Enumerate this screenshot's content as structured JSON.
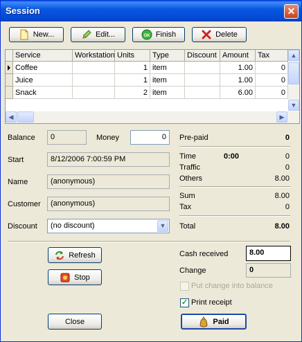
{
  "window": {
    "title": "Session"
  },
  "toolbar": {
    "new_label": "New...",
    "edit_label": "Edit...",
    "finish_label": "Finish",
    "delete_label": "Delete"
  },
  "grid": {
    "columns": [
      "Service",
      "Workstation",
      "Units",
      "Type",
      "Discount",
      "Amount",
      "Tax"
    ],
    "rows": [
      {
        "service": "Coffee",
        "workstation": "",
        "units": "1",
        "type": "item",
        "discount": "",
        "amount": "1.00",
        "tax": "0"
      },
      {
        "service": "Juice",
        "workstation": "",
        "units": "1",
        "type": "item",
        "discount": "",
        "amount": "1.00",
        "tax": "0"
      },
      {
        "service": "Snack",
        "workstation": "",
        "units": "2",
        "type": "item",
        "discount": "",
        "amount": "6.00",
        "tax": "0"
      }
    ]
  },
  "form": {
    "balance_label": "Balance",
    "balance_value": "0",
    "money_label": "Money",
    "money_value": "0",
    "start_label": "Start",
    "start_value": "8/12/2006 7:00:59 PM",
    "name_label": "Name",
    "name_value": "(anonymous)",
    "customer_label": "Customer",
    "customer_value": "(anonymous)",
    "discount_label": "Discount",
    "discount_value": "(no discount)"
  },
  "summary": {
    "prepaid_label": "Pre-paid",
    "prepaid_value": "0",
    "time_label": "Time",
    "time_duration": "0:00",
    "time_value": "0",
    "traffic_label": "Traffic",
    "traffic_value": "0",
    "others_label": "Others",
    "others_value": "8.00",
    "sum_label": "Sum",
    "sum_value": "8.00",
    "tax_label": "Tax",
    "tax_value": "0",
    "total_label": "Total",
    "total_value": "8.00"
  },
  "actions": {
    "refresh_label": "Refresh",
    "stop_label": "Stop",
    "close_label": "Close",
    "paid_label": "Paid"
  },
  "payment": {
    "cash_received_label": "Cash received",
    "cash_received_value": "8.00",
    "change_label": "Change",
    "change_value": "0",
    "put_change_label": "Put change into balance",
    "put_change_checked": false,
    "print_receipt_label": "Print receipt",
    "print_receipt_checked": true
  }
}
